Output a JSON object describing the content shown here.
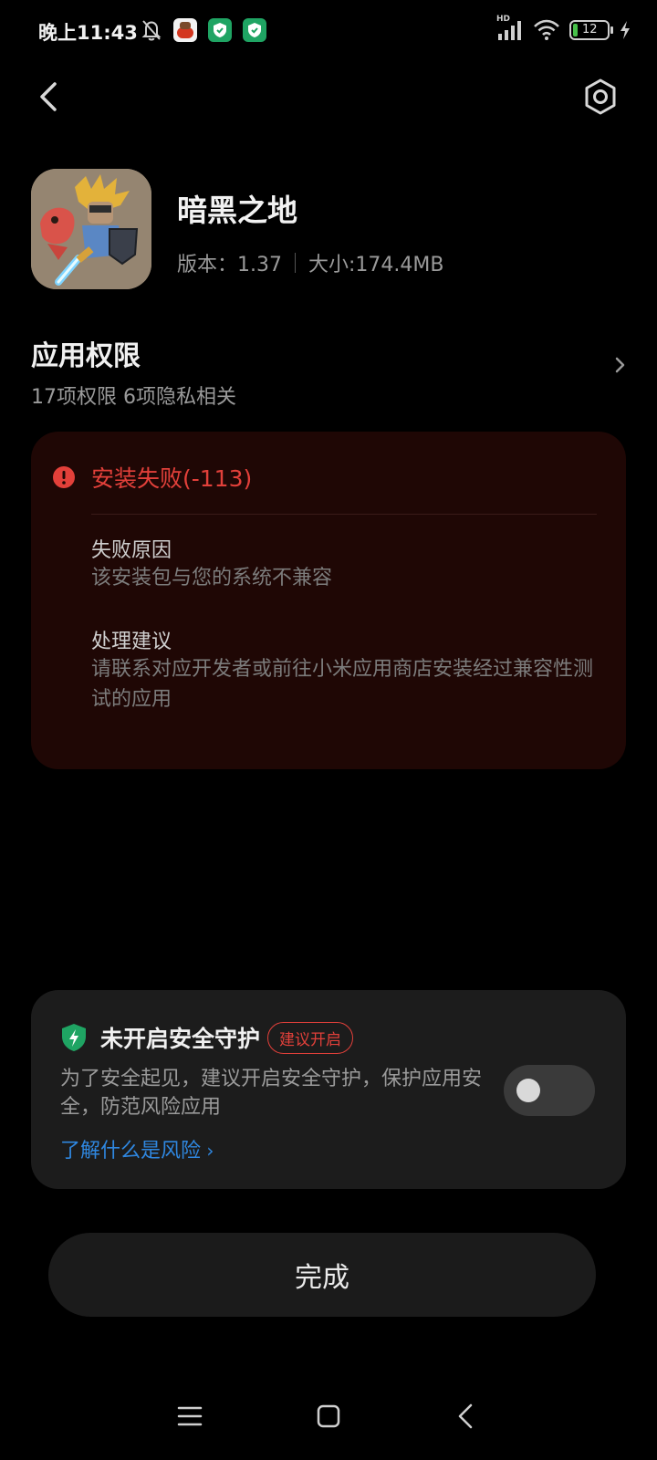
{
  "status_bar": {
    "time": "晚上11:43",
    "battery": "12",
    "network": "HD"
  },
  "app": {
    "name": "暗黑之地",
    "version_label": "版本：1.37",
    "size_label": "大小:174.4MB"
  },
  "permissions": {
    "title": "应用权限",
    "summary": "17项权限 6项隐私相关"
  },
  "error": {
    "title": "安装失败(-113)",
    "reason_label": "失败原因",
    "reason_text": "该安装包与您的系统不兼容",
    "advice_label": "处理建议",
    "advice_text": "请联系对应开发者或前往小米应用商店安装经过兼容性测试的应用"
  },
  "security": {
    "title": "未开启安全守护",
    "badge": "建议开启",
    "description": "为了安全起见，建议开启安全守护，保护应用安全，防范风险应用",
    "link": "了解什么是风险",
    "toggle_on": false
  },
  "done_button": "完成",
  "colors": {
    "accent_red": "#e2403a",
    "link_blue": "#2f87e0",
    "shield_green": "#1fa463"
  }
}
